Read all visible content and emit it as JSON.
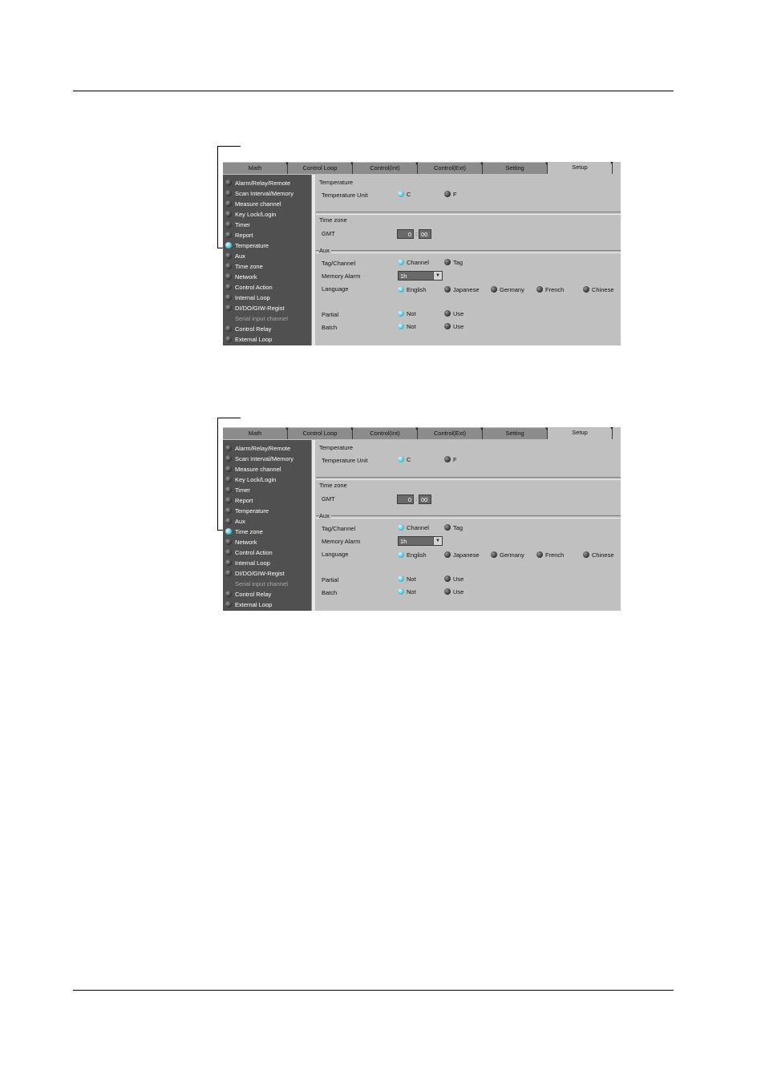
{
  "tabs": [
    "Math",
    "Control Loop",
    "Control(Int)",
    "Control(Ext)",
    "Setting",
    "Setup"
  ],
  "sidebar_items": [
    "Alarm/Relay/Remote",
    "Scan Interval/Memory",
    "Measure channel",
    "Key Lock/Login",
    "Timer",
    "Report",
    "Temperature",
    "Aux",
    "Time zone",
    "Network",
    "Control Action",
    "Internal Loop",
    "DI/DO/GIW-Regist",
    "Serial input channel",
    "Control Relay",
    "External Loop"
  ],
  "temperature": {
    "group_title": "Temperature",
    "unit_label": "Temperature Unit",
    "opt_c": "C",
    "opt_f": "F"
  },
  "timezone": {
    "group_title": "Time zone",
    "gmt_label": "GMT",
    "hours": "0",
    "sep": ":",
    "minutes": "00"
  },
  "aux": {
    "group_title": "Aux",
    "tag_label": "Tag/Channel",
    "opt_channel": "Channel",
    "opt_tag": "Tag",
    "memory_label": "Memory Alarm",
    "memory_value": "1h",
    "language_label": "Language",
    "languages": [
      "English",
      "Japanese",
      "Germany",
      "French",
      "Chinese"
    ],
    "partial_label": "Partial",
    "batch_label": "Batch",
    "opt_not": "Not",
    "opt_use": "Use"
  },
  "screens": [
    {
      "selected_item": "Temperature"
    },
    {
      "selected_item": "Time zone"
    }
  ],
  "colors": {
    "led_on": "#3fb4c8",
    "led_off": "#2e2e2e",
    "sidebar_bg": "#505050",
    "panel_bg": "#c0c0c0"
  }
}
